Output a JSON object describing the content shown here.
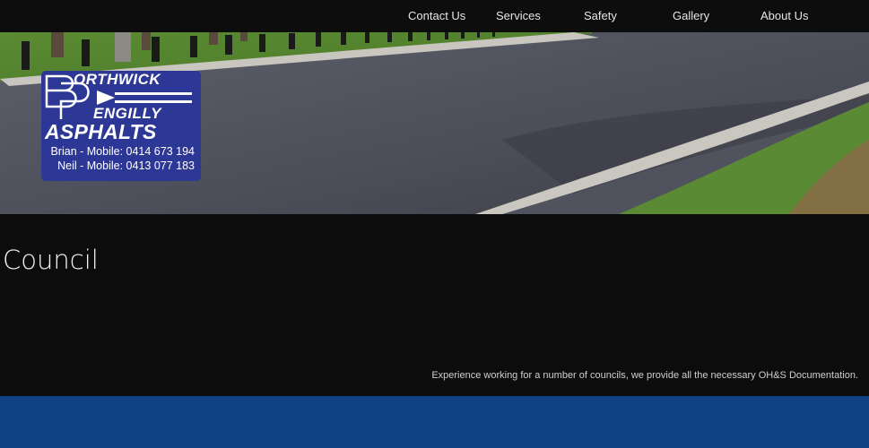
{
  "nav": {
    "items": [
      {
        "label": "Contact Us"
      },
      {
        "label": "Services"
      },
      {
        "label": "Safety"
      },
      {
        "label": "Gallery"
      },
      {
        "label": "About Us"
      }
    ]
  },
  "logo": {
    "line1": "ORTHWICK",
    "line2": "ENGILLY",
    "line3": "ASPHALTS",
    "contact1": "Brian - Mobile: 0414 673 194",
    "contact2": "Neil - Mobile: 0413 077 183",
    "colors": {
      "background": "#2c3796",
      "text": "#ffffff"
    }
  },
  "main": {
    "title": "Council",
    "description": "Experience working for a number of councils, we provide all the necessary OH&S Documentation."
  },
  "colors": {
    "nav_bg": "#0d0d0d",
    "page_bg": "#0c0c0c",
    "footer_band": "#0e4284"
  }
}
